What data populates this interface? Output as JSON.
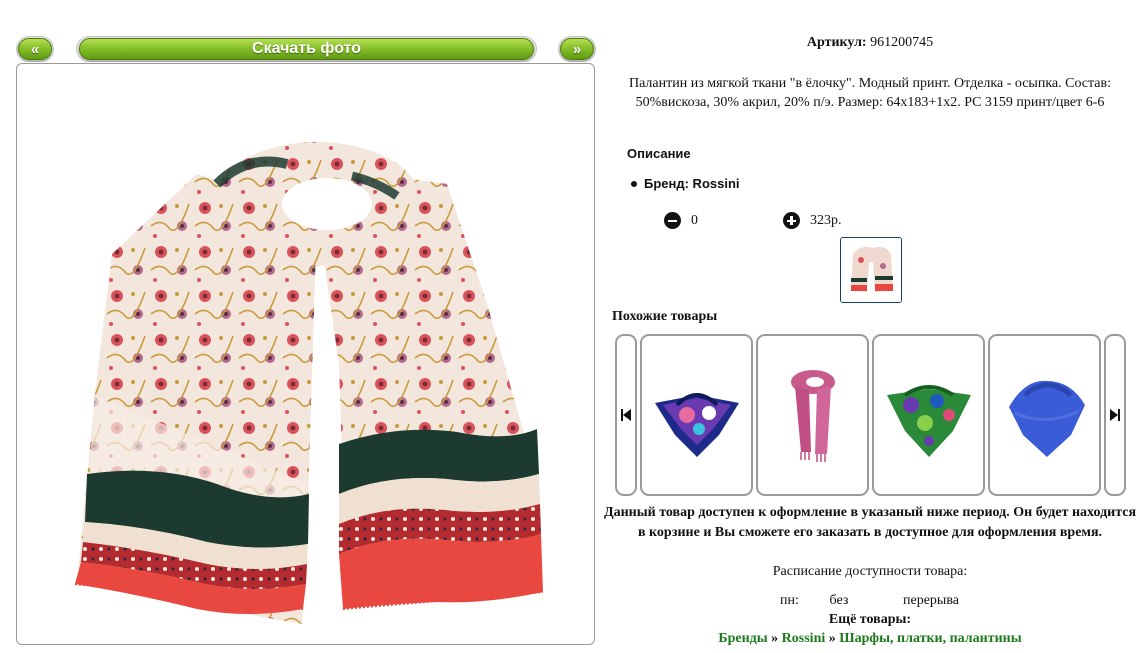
{
  "gallery": {
    "prev_label": "«",
    "next_label": "»",
    "download_label": "Скачать фото"
  },
  "product": {
    "article_label": "Артикул:",
    "article_value": "961200745",
    "description": "Палантин из мягкой ткани \"в ёлочку\". Модный принт. Отделка - осыпка. Состав: 50%вискоза, 30% акрил, 20% п/э. Размер: 64х183+1х2. PC 3159 принт/цвет 6-6",
    "section_title": "Описание",
    "brand_line": "Бренд: Rossini",
    "quantity": "0",
    "price": "323р."
  },
  "similar": {
    "title": "Похожие товары"
  },
  "availability": {
    "note": "Данный товар доступен к оформление в указаный ниже период. Он будет находится в корзине и Вы сможете его заказать в доступное для оформления время.",
    "schedule_title": "Расписание доступности товара:",
    "day": "пн:",
    "from": "без",
    "to": "перерыва",
    "more_title": "Ещё товары:"
  },
  "breadcrumbs": {
    "items": [
      "Бренды",
      "Rossini",
      "Шарфы, платки, палантины"
    ],
    "separator": "»"
  },
  "colors": {
    "button_green": "#87c02a",
    "link_green": "#1c7a1c",
    "frame_border": "#9a9a9a",
    "thumb_border": "#16425b"
  }
}
